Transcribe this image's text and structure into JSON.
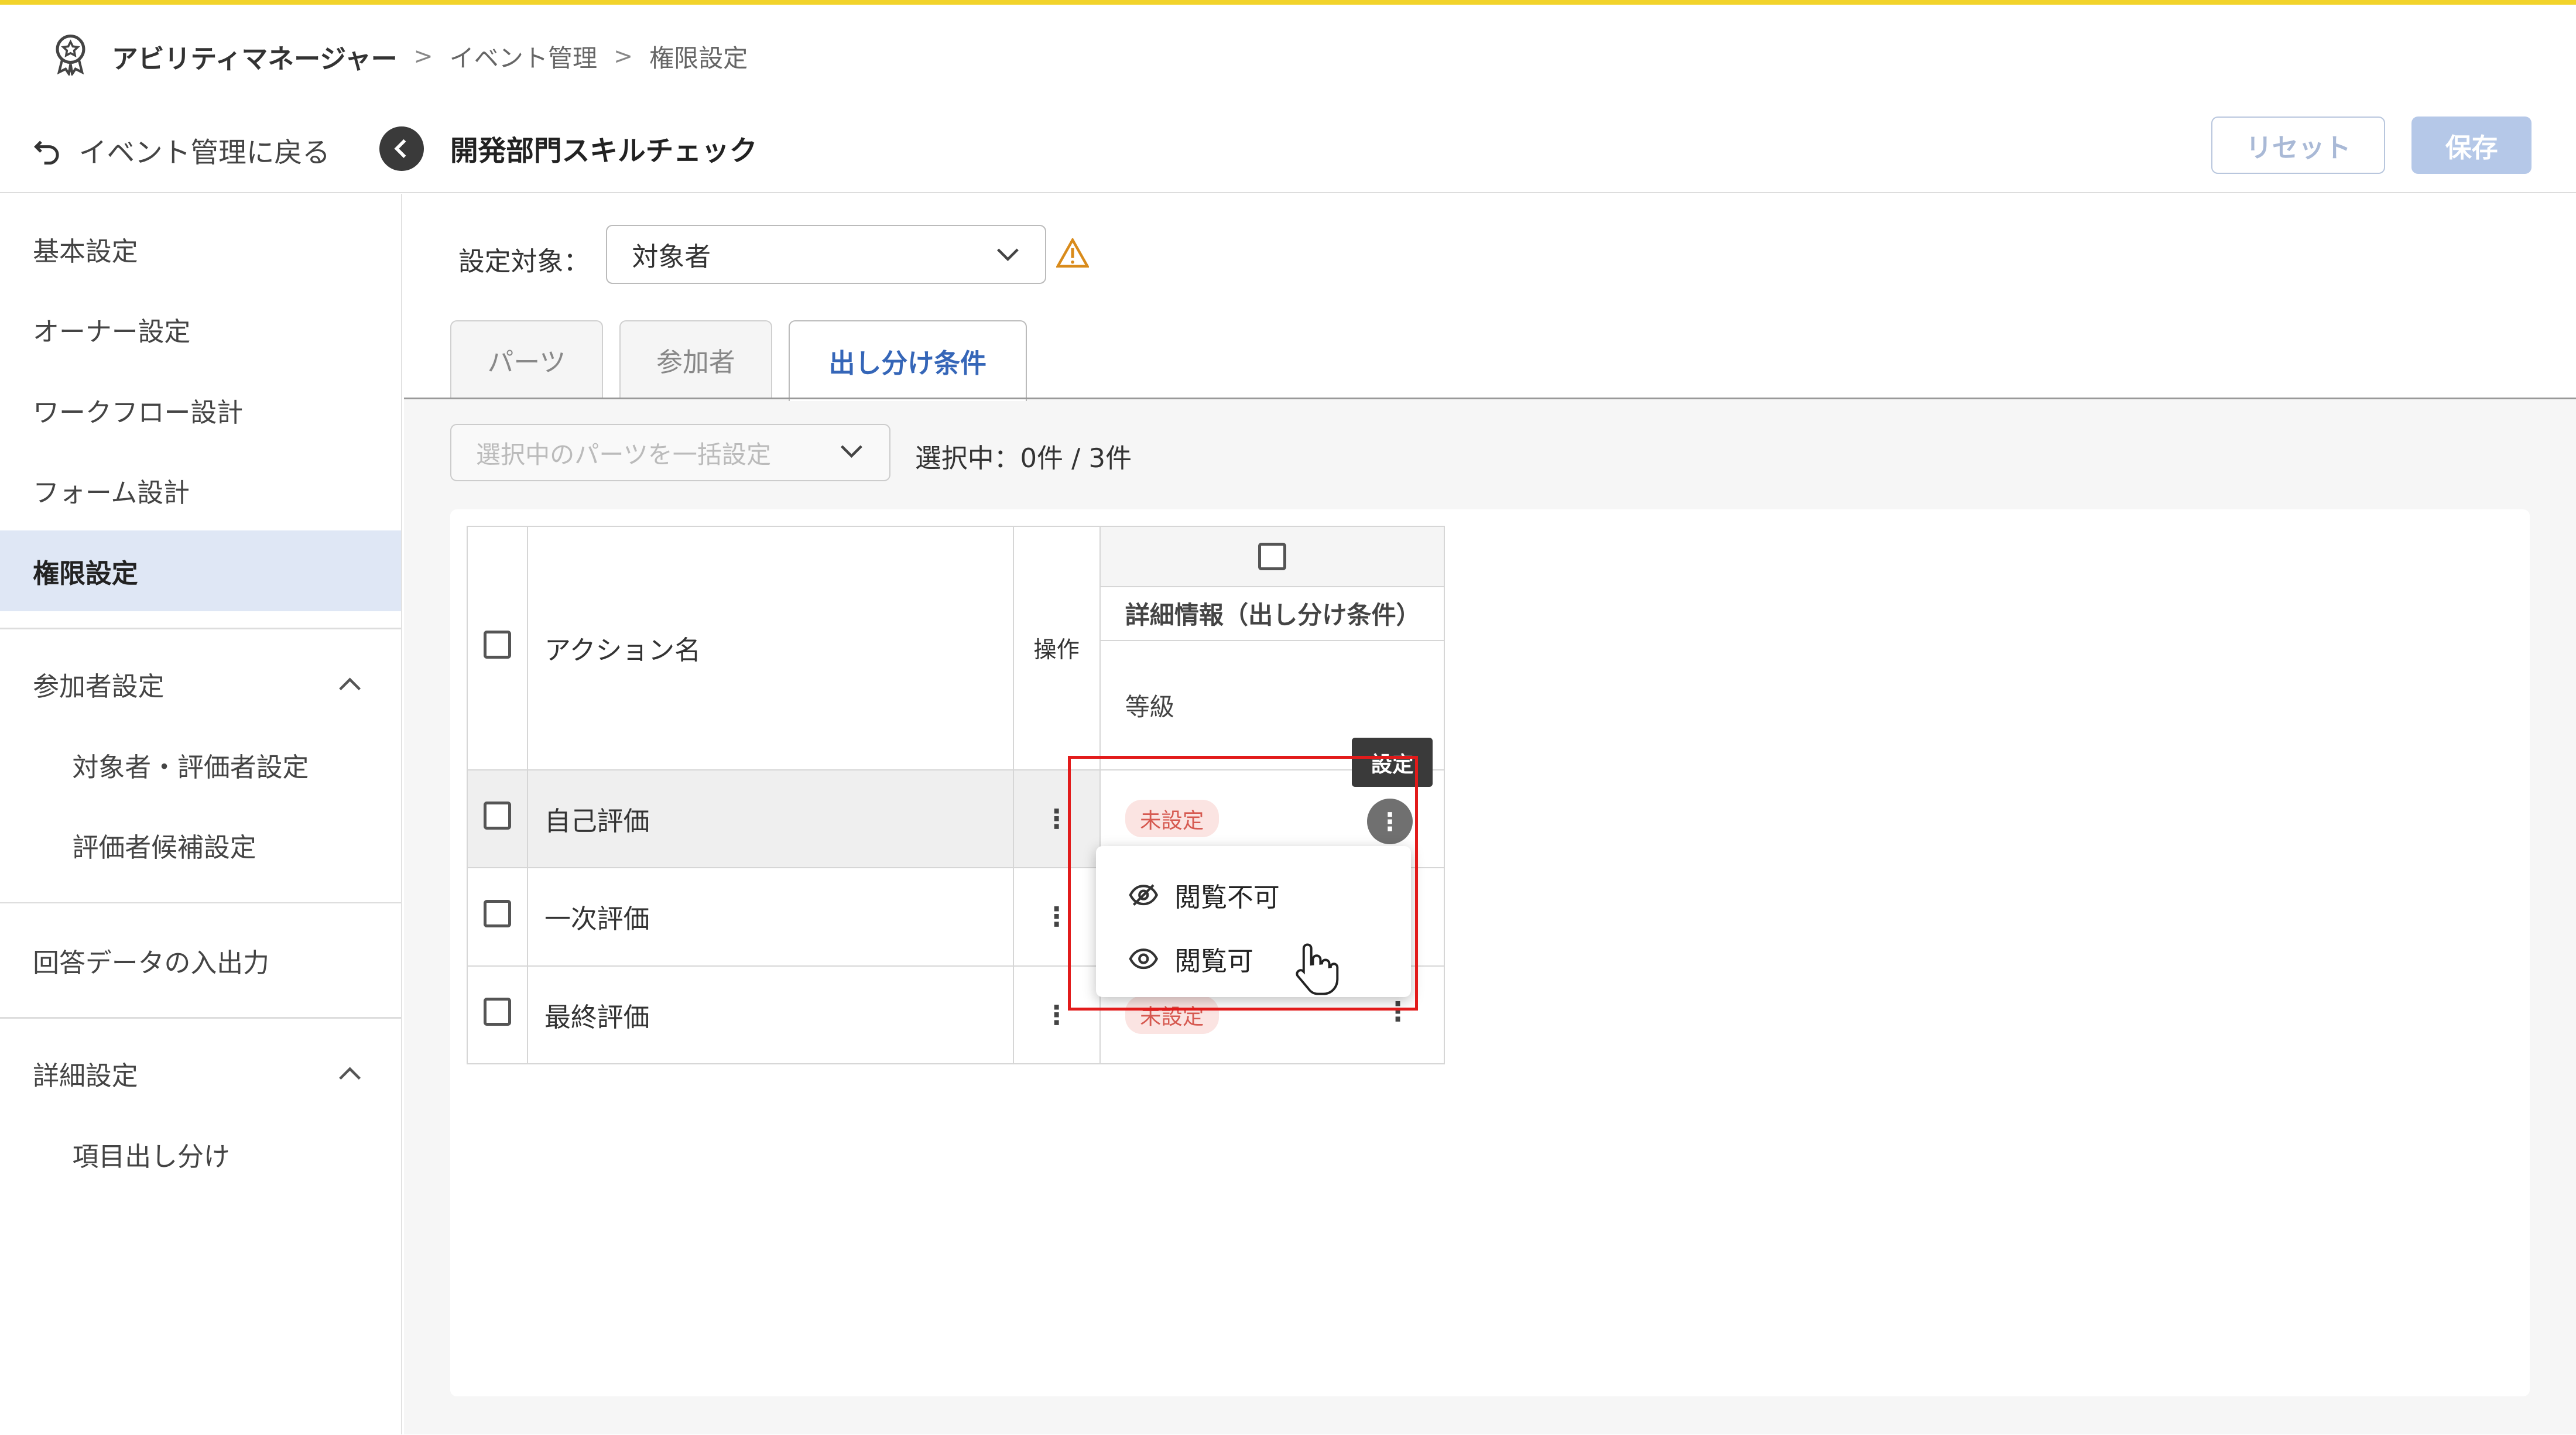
{
  "breadcrumb": {
    "app": "アビリティマネージャー",
    "sep": ">",
    "items": [
      "イベント管理",
      "権限設定"
    ]
  },
  "subbar": {
    "back_label": "イベント管理に戻る",
    "title": "開発部門スキルチェック",
    "reset_label": "リセット",
    "save_label": "保存"
  },
  "sidebar": {
    "basic": "基本設定",
    "owner": "オーナー設定",
    "workflow": "ワークフロー設計",
    "form": "フォーム設計",
    "permission": "権限設定",
    "participants": "参加者設定",
    "targets": "対象者・評価者設定",
    "candidates": "評価者候補設定",
    "io": "回答データの入出力",
    "detail": "詳細設定",
    "split": "項目出し分け"
  },
  "target": {
    "label": "設定対象：",
    "value": "対象者"
  },
  "tabs": [
    "パーツ",
    "参加者",
    "出し分け条件"
  ],
  "bulk": {
    "placeholder": "選択中のパーツを一括設定",
    "count": "選択中：0件 / 3件"
  },
  "table": {
    "col_name": "アクション名",
    "col_op": "操作",
    "col_detail": "詳細情報（出し分け条件）",
    "col_sub": "等級",
    "rows": [
      {
        "name": "自己評価",
        "status": "未設定"
      },
      {
        "name": "一次評価",
        "status": ""
      },
      {
        "name": "最終評価",
        "status": "未設定"
      }
    ]
  },
  "tooltip": "設定",
  "menu": {
    "hidden": "閲覧不可",
    "visible": "閲覧可"
  },
  "colors": {
    "accent": "#3566b8",
    "highlight": "#e21b1b",
    "top_border": "#f2d32b"
  }
}
